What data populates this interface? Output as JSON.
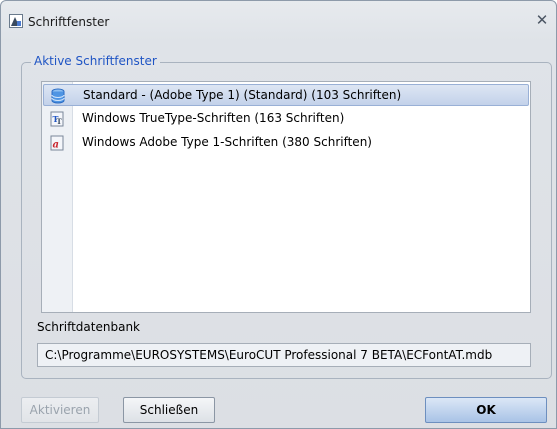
{
  "window": {
    "title": "Schriftfenster"
  },
  "group": {
    "label": "Aktive Schriftfenster"
  },
  "font_list": {
    "items": [
      {
        "label": "Standard - (Adobe Type 1) (Standard) (103 Schriften)",
        "icon": "database-icon",
        "selected": true
      },
      {
        "label": "Windows TrueType-Schriften (163 Schriften)",
        "icon": "truetype-font-icon",
        "selected": false
      },
      {
        "label": "Windows Adobe Type 1-Schriften (380 Schriften)",
        "icon": "adobe-type1-font-icon",
        "selected": false
      }
    ]
  },
  "database": {
    "label": "Schriftdatenbank",
    "path": "C:\\Programme\\EUROSYSTEMS\\EuroCUT Professional 7 BETA\\ECFontAT.mdb"
  },
  "buttons": {
    "activate": "Aktivieren",
    "close": "Schließen",
    "ok": "OK"
  },
  "colors": {
    "group_label": "#1f55c4",
    "selection": "#c3d2ea"
  }
}
